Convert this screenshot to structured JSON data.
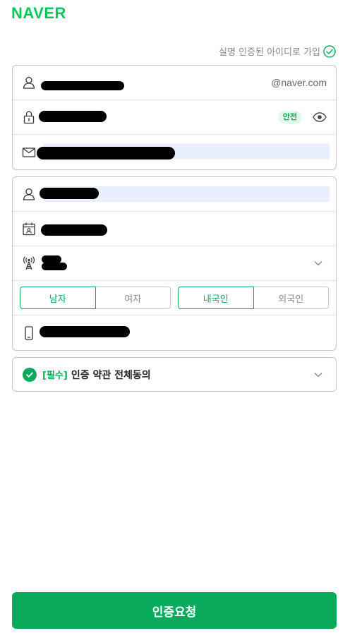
{
  "brand": {
    "logo": "NAVER"
  },
  "realname_link": {
    "label": "실명 인증된 아이디로 가입"
  },
  "account": {
    "id_suffix": "@naver.com",
    "password_badge": "안전"
  },
  "profile": {
    "gender": {
      "options": [
        "남자",
        "여자"
      ],
      "selected": "남자"
    },
    "nationality": {
      "options": [
        "내국인",
        "외국인"
      ],
      "selected": "내국인"
    }
  },
  "terms": {
    "required_tag": "[필수]",
    "label": "인증 약관 전체동의"
  },
  "submit": {
    "label": "인증요청"
  },
  "colors": {
    "accent": "#09aa5c",
    "logo": "#03c75a",
    "autofill": "#e8f0fe"
  },
  "icons": [
    "person-icon",
    "lock-icon",
    "mail-icon",
    "calendar-icon",
    "antenna-icon",
    "phone-icon",
    "eye-icon",
    "chevron-down-icon",
    "check-circle-icon"
  ]
}
